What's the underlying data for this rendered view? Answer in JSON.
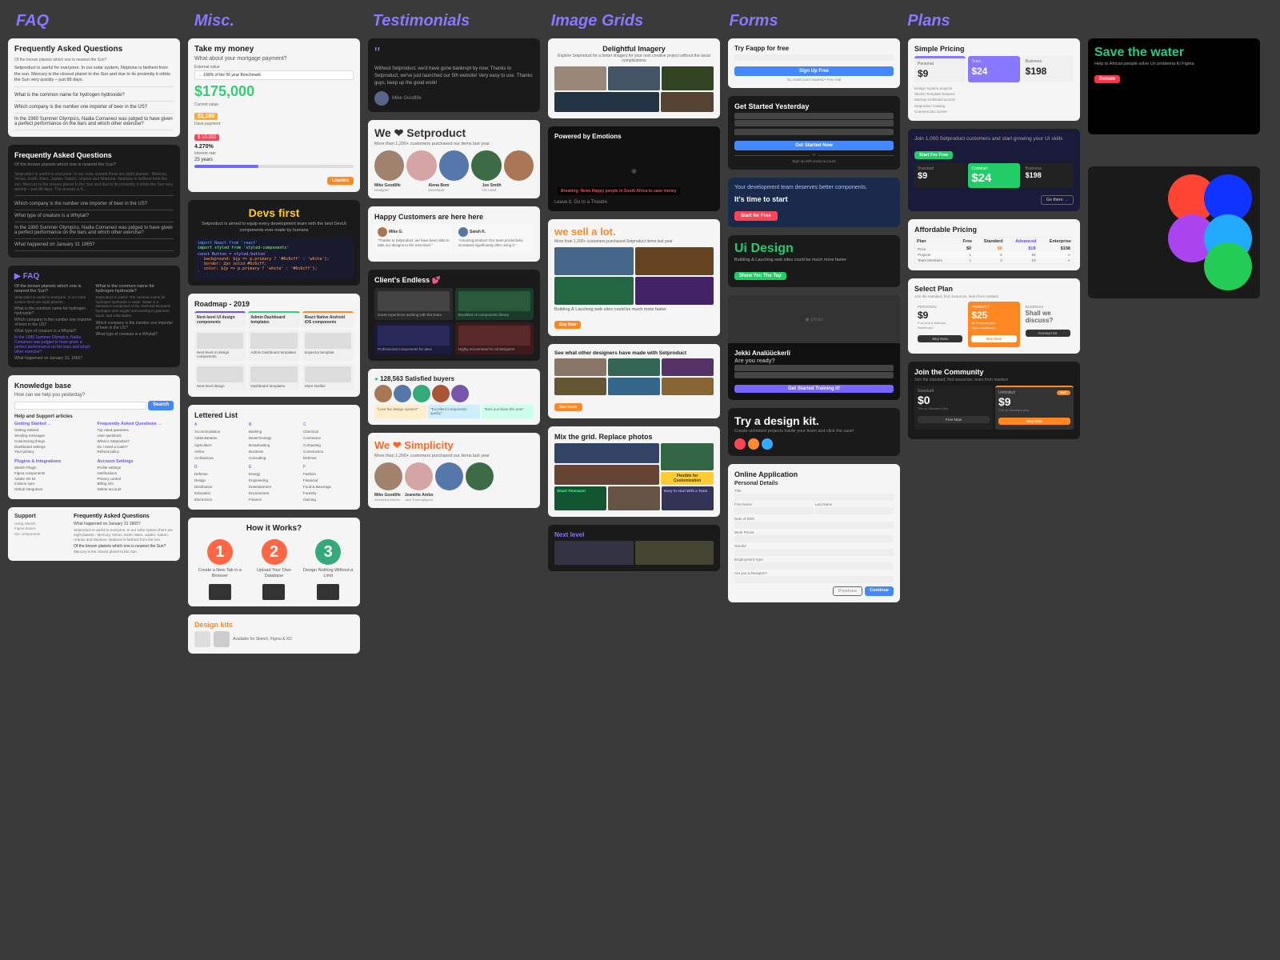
{
  "headers": {
    "col1": "FAQ",
    "col2": "Misc.",
    "col3": "Testimonials",
    "col4": "Image Grids",
    "col5": "Forms",
    "col6": "Plans",
    "col7": ""
  },
  "faq": {
    "title1": "Frequently Asked Questions",
    "title2": "Frequently Asked Questions",
    "title3": "FAQ",
    "knowledge": "Knowledge base",
    "support": "Support",
    "q1": "Of the known planets which one is nearest the Sun?",
    "q2": "What is the common name for hydrogen hydroxide?",
    "q3": "Which company is the number one importer of beer in the US?",
    "q4": "In the 1980 Summer Olympics, Nadia Comaneci was judged to have given a perfect performance on the bars and which other exercise?",
    "q5": "What happened on January 31 1865?"
  },
  "misc": {
    "mortgage": "Take my money",
    "mortgage_q": "What about your mortgage payment?",
    "amount": "$175,000",
    "monthly": "$1,160",
    "rate": "4.270%",
    "years": "25 years",
    "devs": "Devs first",
    "devs_sub": "Setproduct is aimed to equip every development team with the best DevUI components ever made by humans",
    "roadmap": "Roadmap - 2019",
    "next_ui": "Next-level UI design components",
    "admin": "Admin Dashboard templates",
    "react": "React Native Android iOS components",
    "lettered": "Lettered List",
    "how_it_works": "How it Works?",
    "step1": "Create a New Tab in a Browser",
    "step2": "Upload Your Own Database",
    "step3": "Design Nothing Without a Limit",
    "design_kit": "Design kits"
  },
  "testimonials": {
    "quote1": "Without Setproduct, we'd have gone bankrupt by now. Thanks to Setproduct, we've just launched our 5th website! Very easy to use. Thanks guys, keep up the good work!",
    "author1": "Mike Goodlife",
    "we_love": "We ❤ Setproduct",
    "sub": "More than 1,200+ customers purchased our items last year",
    "happy": "Happy Customers are here here",
    "clients": "Client's Endless 💕",
    "buyers": "128,563 Satisfied buyers",
    "we_simplicity": "We ❤ Simplicity",
    "sub2": "More than 1,200+ customers purchased our items last year"
  },
  "image_grids": {
    "title1": "Delightful Imagery",
    "sub1": "Explore Setproduct for a better imagery for your next creative project without the usual complications",
    "emotions": "Powered by Emotions",
    "sell": "we sell a lot.",
    "sell_sub": "More than 1,200+ customers purchased Setproduct items last year",
    "see_what": "See what other designers have made with Setproduct",
    "mix": "Mix the grid. Replace photos",
    "flexible": "Flexible for Customization",
    "smart": "Smart Timesacer",
    "easy": "Easy to start With a Team",
    "next_level": "Next level"
  },
  "forms": {
    "try_free": "Try Faqpp for free",
    "get_started": "Get Started Yesterday",
    "deserves": "Your development team deserves better components.",
    "time_to": "It's time to start",
    "ui_design": "Ui Design",
    "ui_sub": "Building & Lauching web sites could be much more faster",
    "jekki": "Jekki Analüückerli",
    "are_you": "Are you ready?",
    "try_design": "Try a design kit.",
    "try_sub": "Create unlimited projects inside your team and click the save!",
    "online": "Online Application",
    "personal": "Personal Details"
  },
  "plans": {
    "simple": "Simple Pricing",
    "prices_simple": [
      "$9",
      "$24"
    ],
    "join": "Join 1,000 Setproduct customers and start growing your UI skills",
    "standard": "Standard",
    "coolstart": "Coolstart",
    "business": "Business",
    "price_s": "$9",
    "price_c": "$24",
    "price_b": "$198",
    "affordable": "Affordable Pricing",
    "free": "Free",
    "standard2": "Standard",
    "advanced": "Advanced",
    "enterprise": "Enterprise",
    "p_free": "$0",
    "p_standard": "$8",
    "p_advanced": "$18",
    "p_enterprise": "$198",
    "select_plan": "Select Plan",
    "personal": "PERSONAL",
    "product": "PRODUCT",
    "business2": "BUSINESS",
    "sp_price1": "$9",
    "sp_price2": "$25",
    "sp_tagline": "Shall we discuss?",
    "join_community": "Join the Community",
    "join_sub": "Join the standard, find resources, learn from masters",
    "standard_c": "Standard",
    "unlimited": "Unlimited",
    "c_price1": "$0",
    "c_price2": "$9"
  }
}
